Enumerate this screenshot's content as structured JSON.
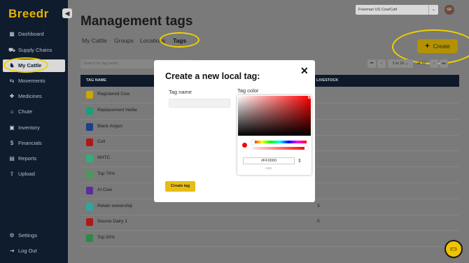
{
  "app": {
    "logo": "Breedr",
    "org_select": "Freeman US Cow/Calf",
    "avatar_initials": "GF"
  },
  "sidebar": {
    "items": [
      {
        "label": "Dashboard",
        "icon": "grid-icon",
        "glyph": "▦"
      },
      {
        "label": "Supply Chains",
        "icon": "truck-icon",
        "glyph": "⛟"
      },
      {
        "label": "My Cattle",
        "icon": "cow-icon",
        "glyph": "♞",
        "active": true
      },
      {
        "label": "Movements",
        "icon": "transfer-icon",
        "glyph": "⇆"
      },
      {
        "label": "Medicines",
        "icon": "medicine-icon",
        "glyph": "✚"
      },
      {
        "label": "Chute",
        "icon": "chute-icon",
        "glyph": "⌂"
      },
      {
        "label": "Inventory",
        "icon": "inventory-icon",
        "glyph": "▣"
      },
      {
        "label": "Financials",
        "icon": "dollar-icon",
        "glyph": "$"
      },
      {
        "label": "Reports",
        "icon": "report-icon",
        "glyph": "▤"
      },
      {
        "label": "Upload",
        "icon": "upload-icon",
        "glyph": "⇧"
      }
    ],
    "bottom": [
      {
        "label": "Settings",
        "icon": "gear-icon",
        "glyph": "⚙"
      },
      {
        "label": "Log Out",
        "icon": "logout-icon",
        "glyph": "⇥"
      }
    ]
  },
  "header": {
    "title": "Management tags",
    "tabs": [
      "My Cattle",
      "Groups",
      "Locations",
      "Tags"
    ],
    "active_tab": "Tags",
    "create_label": "Create"
  },
  "toolbar": {
    "search_placeholder": "Search by tag name",
    "range": "1 to 10",
    "of": "of 10"
  },
  "table": {
    "columns": [
      "TAG NAME",
      "LIVESTOCK"
    ],
    "rows": [
      {
        "name": "Registered Cow",
        "color": "#c9a800",
        "count": ""
      },
      {
        "name": "Replacement Heifer",
        "color": "#1c9f72",
        "count": ""
      },
      {
        "name": "Black Angus",
        "color": "#1d3f8a",
        "count": ""
      },
      {
        "name": "Cull",
        "color": "#b01818",
        "count": ""
      },
      {
        "name": "NHTC",
        "color": "#2fae7a",
        "count": ""
      },
      {
        "name": "Top 70%",
        "color": "#4c9a5a",
        "count": ""
      },
      {
        "name": "AI Cow",
        "color": "#5b2f9a",
        "count": ""
      },
      {
        "name": "Retain ownership",
        "color": "#2aa8a0",
        "count": "3"
      },
      {
        "name": "Source Dairy 1",
        "color": "#b01818",
        "count": "0"
      },
      {
        "name": "Top 50%",
        "color": "#2a8a4a",
        "count": ""
      }
    ]
  },
  "modal": {
    "title": "Create a new local tag:",
    "name_label": "Tag name",
    "name_value": "",
    "color_label": "Tag color",
    "hex_value": "#FF0000",
    "hex_caption": "HEX",
    "submit_label": "Create tag",
    "picker_color": "#ff0000"
  }
}
